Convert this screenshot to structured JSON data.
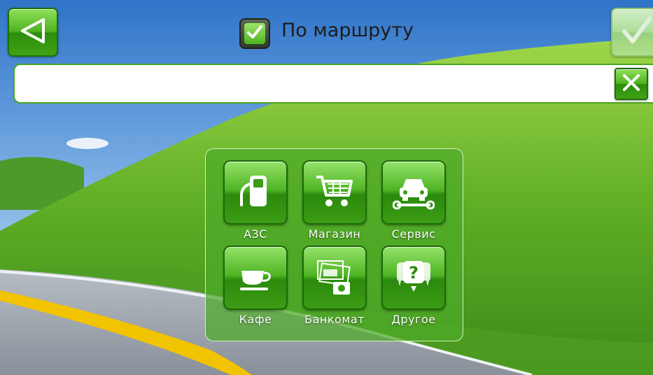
{
  "header": {
    "back_icon": "back-triangle-icon",
    "route_checkbox_checked": true,
    "route_label": "По маршруту",
    "confirm_icon": "checkmark-icon"
  },
  "search": {
    "value": "",
    "placeholder": "",
    "clear_icon": "close-x-icon"
  },
  "categories": [
    {
      "label": "АЗС",
      "icon": "fuel-pump-icon"
    },
    {
      "label": "Магазин",
      "icon": "shopping-cart-icon"
    },
    {
      "label": "Сервис",
      "icon": "car-service-icon"
    },
    {
      "label": "Кафе",
      "icon": "coffee-cup-icon"
    },
    {
      "label": "Банкомат",
      "icon": "atm-cash-icon"
    },
    {
      "label": "Другое",
      "icon": "question-bubble-icon"
    }
  ],
  "colors": {
    "accent_green": "#4fb320",
    "border_green": "#1f6f06"
  }
}
